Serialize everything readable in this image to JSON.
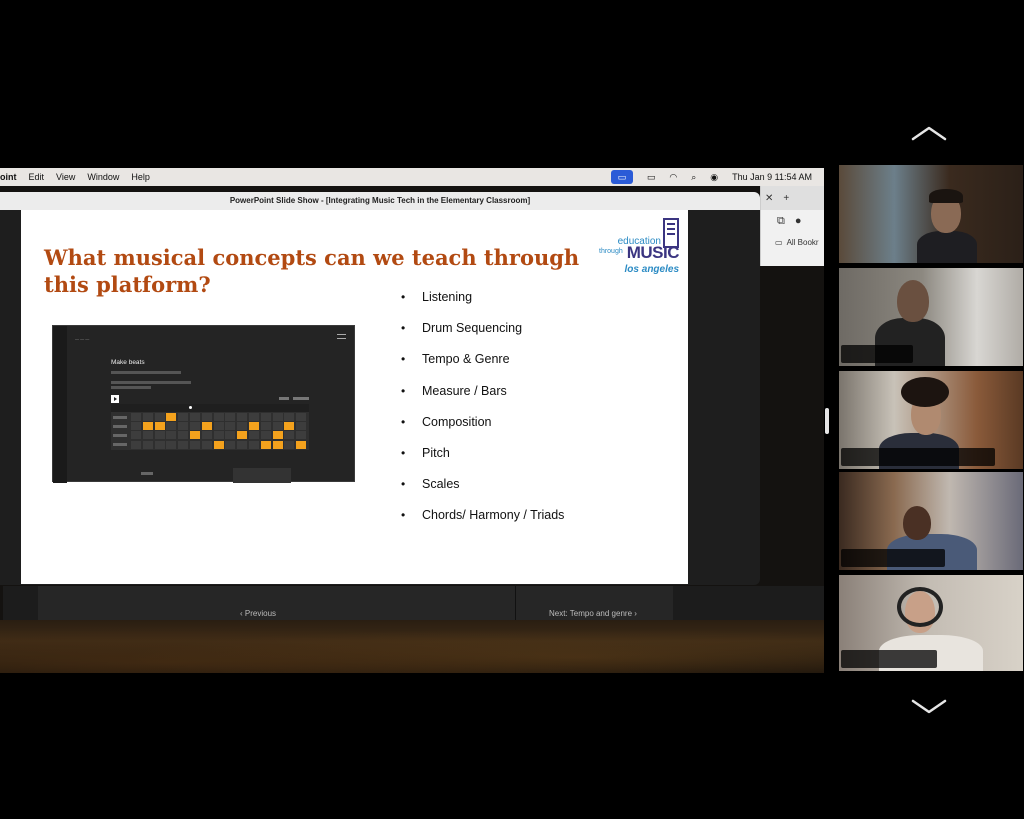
{
  "mac_menubar": {
    "items": [
      "oint",
      "Edit",
      "View",
      "Window",
      "Help"
    ],
    "clock": "Thu Jan 9  11:54 AM"
  },
  "browser": {
    "new_tab_icon": "+",
    "bookmarks_label": "All Bookr"
  },
  "powerpoint": {
    "window_title": "PowerPoint Slide Show - [Integrating Music Tech in the Elementary Classroom]",
    "slide": {
      "title": "What musical concepts can we teach through this platform?",
      "logo": {
        "line1": "education",
        "line2": "through",
        "line3": "MUSIC",
        "line4": "los angeles"
      },
      "bullets": [
        "Listening",
        "Drum Sequencing",
        "Tempo & Genre",
        "Measure / Bars",
        "Composition",
        "Pitch",
        "Scales",
        "Chords/ Harmony / Triads"
      ],
      "embedded_app": {
        "heading": "Make beats"
      }
    },
    "presenter": {
      "previous_label": "‹ Previous",
      "next_label": "Next: Tempo and genre ›"
    }
  },
  "colors": {
    "slide_title": "#b24a12",
    "beat_on": "#f4a21d",
    "logo_blue": "#2b8bc4",
    "logo_purple": "#3b3581"
  }
}
